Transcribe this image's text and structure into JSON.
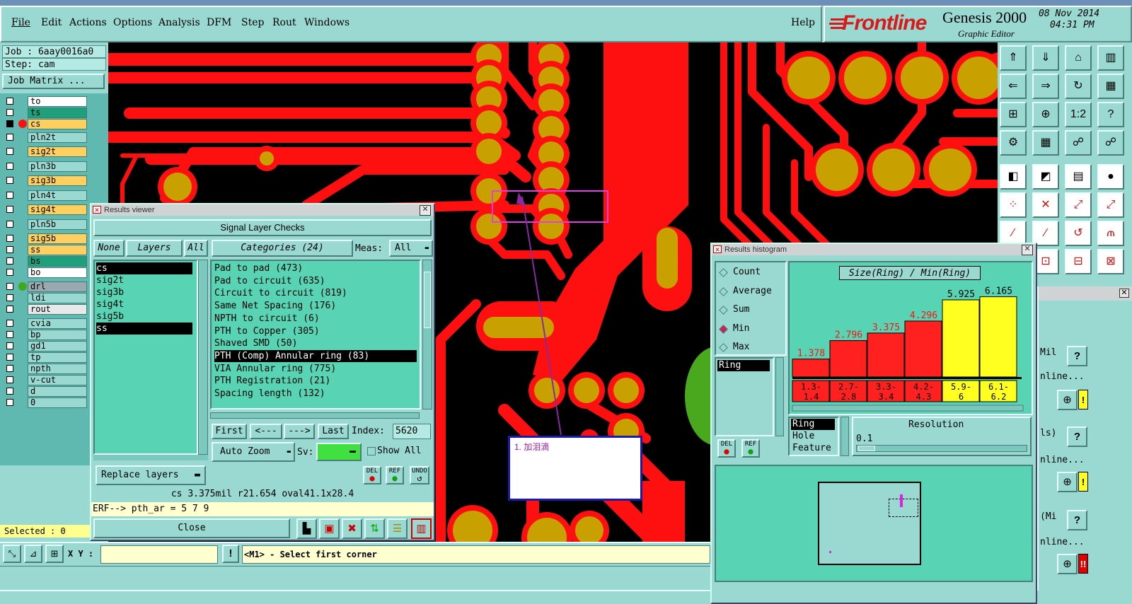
{
  "menubar": {
    "items": [
      "File",
      "Edit",
      "Actions",
      "Options",
      "Analysis",
      "DFM",
      "Step",
      "Rout",
      "Windows"
    ],
    "help": "Help"
  },
  "brand": {
    "logo": "Frontline",
    "product": "Genesis 2000",
    "subtitle": "Graphic Editor",
    "date": "08 Nov 2014",
    "time": "04:31 PM",
    "accent_color": "#d81a1a"
  },
  "left_panel": {
    "job": "Job : 6aay0016a0",
    "step": "Step: cam",
    "job_matrix_button": "Job Matrix ...",
    "layers": [
      {
        "name": "to",
        "color": "#ffffff"
      },
      {
        "name": "ts",
        "color": "#1f9f7a"
      },
      {
        "name": "cs",
        "color": "#ffd060"
      },
      {
        "name": "pln2t",
        "color": "#9ad9d2"
      },
      {
        "name": "sig2t",
        "color": "#ffd060"
      },
      {
        "name": "pln3b",
        "color": "#9ad9d2"
      },
      {
        "name": "sig3b",
        "color": "#ffd060"
      },
      {
        "name": "pln4t",
        "color": "#9ad9d2"
      },
      {
        "name": "sig4t",
        "color": "#ffd060"
      },
      {
        "name": "pln5b",
        "color": "#9ad9d2"
      },
      {
        "name": "sig5b",
        "color": "#ffd060"
      },
      {
        "name": "ss",
        "color": "#ffd060"
      },
      {
        "name": "bs",
        "color": "#1f9f7a"
      },
      {
        "name": "bo",
        "color": "#ffffff"
      },
      {
        "name": "drl",
        "color": "#9aa8b0"
      },
      {
        "name": "ldi",
        "color": "#9ad9d2"
      },
      {
        "name": "rout",
        "color": "#e8e8e8"
      },
      {
        "name": "cvia",
        "color": "#9ad9d2"
      },
      {
        "name": "bp",
        "color": "#9ad9d2"
      },
      {
        "name": "gd1",
        "color": "#9ad9d2"
      },
      {
        "name": "tp",
        "color": "#9ad9d2"
      },
      {
        "name": "npth",
        "color": "#9ad9d2"
      },
      {
        "name": "v-cut",
        "color": "#9ad9d2"
      },
      {
        "name": "d",
        "color": "#9ad9d2"
      },
      {
        "name": "0",
        "color": "#9ad9d2"
      }
    ],
    "selected": "Selected : 0"
  },
  "results_viewer": {
    "title": "Results viewer",
    "heading": "Signal Layer Checks",
    "none_btn": "None",
    "layers_btn": "Layers",
    "all_btn": "All",
    "layers_list": [
      "cs",
      "sig2t",
      "sig3b",
      "sig4t",
      "sig5b",
      "ss"
    ],
    "categories_btn": "Categories (24)",
    "meas_label": "Meas:",
    "meas_value": "All",
    "categories": [
      "Pad to pad (473)",
      "Pad to circuit (635)",
      "Circuit to circuit (819)",
      "Same Net Spacing (176)",
      "NPTH to circuit (6)",
      "PTH to Copper (305)",
      "Shaved SMD (50)",
      "PTH (Comp) Annular ring (83)",
      "VIA Annular ring (775)",
      "PTH Registration (21)",
      "Spacing length (132)"
    ],
    "selected_category": 7,
    "first": "First",
    "prev": "<---",
    "next": "--->",
    "last": "Last",
    "index_label": "Index:",
    "index_value": "5620",
    "auto_zoom": "Auto Zoom",
    "sv_label": "Sv:",
    "show_all": "Show All",
    "replace_layers": "Replace layers",
    "del": "DEL",
    "ref": "REF",
    "undo": "UNDO",
    "status": "cs 3.375mil  r21.654  oval41.1x28.4",
    "erf": "ERF--> pth_ar = 5 7 9",
    "close": "Close"
  },
  "histogram": {
    "title": "Results histogram",
    "options": [
      "Count",
      "Average",
      "Sum",
      "Min",
      "Max"
    ],
    "selected_option": 3,
    "chart_title": "Size(Ring) / Min(Ring)",
    "list_item": "Ring",
    "list2": [
      "Ring",
      "Hole",
      "Feature"
    ],
    "resolution_label": "Resolution",
    "resolution_value": "0.1",
    "del": "DEL",
    "ref": "REF"
  },
  "chart_data": {
    "type": "bar",
    "title": "Size(Ring) / Min(Ring)",
    "categories": [
      "1.3-1.4",
      "2.7-2.8",
      "3.3-3.4",
      "4.2-4.3",
      "5.9-6",
      "6.1-6.2"
    ],
    "cat_lines": [
      [
        "1.3-",
        "1.4"
      ],
      [
        "2.7-",
        "2.8"
      ],
      [
        "3.3-",
        "3.4"
      ],
      [
        "4.2-",
        "4.3"
      ],
      [
        "5.9-",
        "6"
      ],
      [
        "6.1-",
        "6.2"
      ]
    ],
    "values": [
      1.378,
      2.796,
      3.375,
      4.296,
      5.925,
      6.165
    ],
    "labels": [
      "1.378",
      "2.796",
      "3.375",
      "4.296",
      "5.925",
      "6.165"
    ],
    "colors": [
      "#ff2020",
      "#ff2020",
      "#ff2020",
      "#ff2020",
      "#ffff20",
      "#ffff20"
    ],
    "ylim": [
      0,
      6.5
    ]
  },
  "bottom_bar": {
    "xy_label": "X Y :",
    "xy_value": "",
    "prompt": "<M1> - Select first corner"
  },
  "annotation": {
    "text": "1. 加泪滴"
  },
  "side_fragments": {
    "mil1": "Mil",
    "online1": "nline...",
    "ls": "ls)",
    "online2": "nline...",
    "mi": "(Mi",
    "online3": "nline..."
  },
  "colors": {
    "panel_bg": "#9ad9d2",
    "list_bg": "#58d3b3",
    "copper": "#ff1010",
    "pad": "#c8a000"
  }
}
